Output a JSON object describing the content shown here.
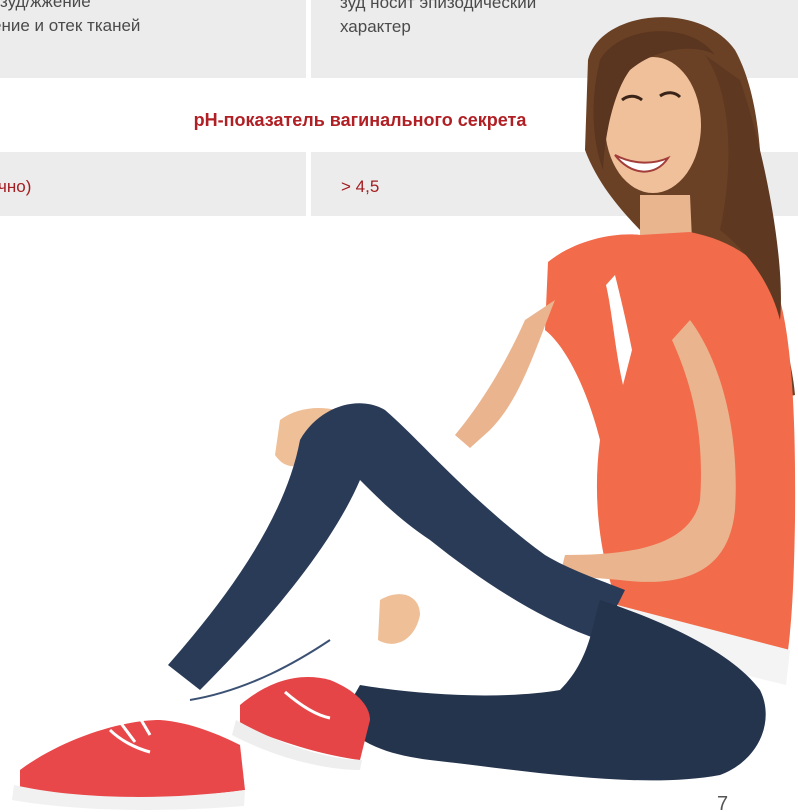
{
  "table": {
    "row_top": {
      "left_line1": "зуд/жжение",
      "left_line2": "ение и отек тканей",
      "right_line1": "зуд носит эпизодический",
      "right_line2": "характер"
    },
    "ph_heading": "pH-показатель вагинального секрета",
    "row_ph": {
      "left": "чно)",
      "right": "> 4,5"
    }
  },
  "page_number": "7",
  "colors": {
    "heading_red": "#b01f24",
    "cell_grey": "#ececec",
    "shirt": "#f26b4a",
    "jeans": "#2a3b57",
    "sneakers": "#e8484a"
  }
}
